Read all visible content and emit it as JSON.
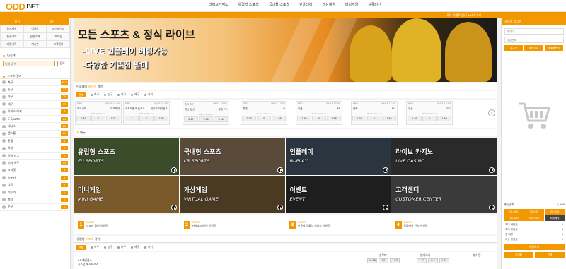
{
  "brand": {
    "logo_main": "ODD",
    "logo_sub": "BET"
  },
  "topnav": [
    "라이브카지노",
    "유럽형 스포츠",
    "국내형 스포츠",
    "인플레이",
    "가상게임",
    "미니게임",
    "실롯머신"
  ],
  "notice_strip": "주요 이벤트 안내 ▶ 바로가기",
  "left": {
    "tabs": [
      "충전",
      "환전"
    ],
    "grid": [
      "공지사항",
      "이벤트",
      "마이페이지",
      "충전내역",
      "환전내역",
      "쪽지함",
      "베팅내역",
      "게시판",
      "고객센터"
    ],
    "search_heading": "팀검색",
    "search_placeholder": "팀명 검색",
    "search_button": "검색",
    "sports_heading": "스포츠 경기",
    "sports": [
      {
        "name": "축구",
        "count": "611"
      },
      {
        "name": "농구",
        "count": "37"
      },
      {
        "name": "야구",
        "count": "20"
      },
      {
        "name": "배구",
        "count": "13"
      },
      {
        "name": "아이스 하키",
        "count": "8"
      },
      {
        "name": "E-Sports",
        "count": "14"
      },
      {
        "name": "테니스",
        "count": "26"
      },
      {
        "name": "핸드볼",
        "count": "19"
      },
      {
        "name": "풋볼",
        "count": "4"
      },
      {
        "name": "럭비",
        "count": "6"
      },
      {
        "name": "럭비 리그",
        "count": "5"
      },
      {
        "name": "미식 축구",
        "count": "12"
      },
      {
        "name": "크리켓",
        "count": "3"
      },
      {
        "name": "스누커",
        "count": "3"
      },
      {
        "name": "다트",
        "count": "2"
      },
      {
        "name": "격투기",
        "count": "5"
      },
      {
        "name": "복싱",
        "count": "2"
      },
      {
        "name": "수구",
        "count": "1"
      }
    ]
  },
  "banner": {
    "title": "모든 스포츠 & 정식 라이브",
    "line1": "-LIVE 인플레이 베팅가능",
    "line2": "-다양한 기준점 발매"
  },
  "live_section": {
    "heading_pre": "인플레이 ",
    "heading_accent": "라이브",
    "heading_post": " 경기"
  },
  "filters": {
    "all": "전체",
    "items": [
      "축구",
      "농구",
      "야구",
      "배구",
      "하키"
    ]
  },
  "matches": [
    {
      "league": "NPB",
      "time": "09/03 14:00",
      "home": "히로시마",
      "away": "요코하마",
      "odds": [
        "1.80",
        "0",
        "1.77"
      ]
    },
    {
      "league": "NPB",
      "time": "09/03 14:00",
      "home": "소프트뱅크 호크스",
      "away": "세이부 라이온스",
      "odds": [
        "2",
        "0",
        "1.86"
      ]
    },
    {
      "league": "중국 축구",
      "time": "09/03 16:00",
      "home": "허난 쑹산",
      "away": "우한 FC",
      "odds": [
        "2.07",
        "3.15",
        "3.50"
      ]
    },
    {
      "league": "KBO",
      "time": "09/03 17:00",
      "home": "롯데",
      "away": "LG",
      "odds": [
        "2.10",
        "0",
        "1.68"
      ]
    },
    {
      "league": "KBO",
      "time": "09/03 17:00",
      "home": "키움",
      "away": "KT",
      "odds": [
        "1.89",
        "0",
        "1.88"
      ]
    },
    {
      "league": "KBO",
      "time": "09/03 17:00",
      "home": "한화",
      "away": "NC",
      "odds": [
        "1.97",
        "0",
        "1.82"
      ]
    },
    {
      "league": "KBO",
      "time": "09/03 17:00",
      "home": "두산",
      "away": "SSG",
      "odds": [
        "1.99",
        "0",
        "1.80"
      ]
    }
  ],
  "match_winner_label": "Match Winner",
  "quick_section": {
    "heading_accent": "퀵",
    "heading_post": " 메뉴"
  },
  "cards": [
    {
      "ko": "유럽형 스포츠",
      "en": "EU SPORTS",
      "bg": "#3b4c2a"
    },
    {
      "ko": "국내형 스포츠",
      "en": "KR SPORTS",
      "bg": "#5a4a3a"
    },
    {
      "ko": "인플레이",
      "en": "IN-PLAY",
      "bg": "#2b3540"
    },
    {
      "ko": "라이브 카지노",
      "en": "LIVE CASINO",
      "bg": "#2a2a2a"
    },
    {
      "ko": "미니게임",
      "en": "MINI GAME",
      "bg": "#7a5a2a"
    },
    {
      "ko": "가상게임",
      "en": "VIRTUAL GAME",
      "bg": "#4a3a22"
    },
    {
      "ko": "이벤트",
      "en": "EVENT",
      "bg": "#1e1e1e"
    },
    {
      "ko": "고객센터",
      "en": "CUSTOMER CENTER",
      "bg": "#3a3a3a"
    }
  ],
  "event_notices": [
    {
      "num": "1",
      "tag": "EVENT",
      "text": "스포츠 폴더 이벤트"
    },
    {
      "num": "2",
      "tag": "EVENT",
      "text": "카지노 페이백 이벤트"
    },
    {
      "num": "3",
      "tag": "EVENT",
      "text": "신규회원 출석 보너스 이벤트"
    },
    {
      "num": "4",
      "tag": "EVENT",
      "text": "인플레이 연승 이벤트"
    }
  ],
  "bottom": {
    "heading_pre": "유럽형 ",
    "heading_accent": "스포츠",
    "heading_post": " 경기",
    "filter_all": "전체",
    "filter_items": [
      "축구",
      "농구",
      "야구",
      "배구",
      "하키"
    ],
    "col_winlose": "승무패",
    "col_handicap": "핸디캡",
    "col_under": "언더오버",
    "team1": "LA 에인절스",
    "team2": "휴스턴 애스트로스",
    "odds": [
      "10.89",
      "VS",
      "1.63",
      "1.77",
      "0.5",
      "1.91"
    ]
  },
  "right": {
    "login_heading": "사용자 로그인",
    "id_placeholder": "아이디",
    "pw_placeholder": "비밀번호",
    "buttons": [
      "로그인",
      "회원가입",
      "비회원문의"
    ],
    "slip_label": "베팅금액",
    "slip_value": "5,000",
    "chips": [
      "10,000",
      "30,000",
      "50,000",
      "100,000",
      "500,000",
      "최대베팅"
    ],
    "summary": [
      {
        "k": "최대 베팅금",
        "v": "0"
      },
      {
        "k": "최대 당첨금",
        "v": "0"
      },
      {
        "k": "총 배당",
        "v": "0"
      },
      {
        "k": "예상 당첨금",
        "v": "0"
      }
    ],
    "bet_button": "베팅하기",
    "sub_buttons": [
      "초기화",
      "전체"
    ]
  }
}
